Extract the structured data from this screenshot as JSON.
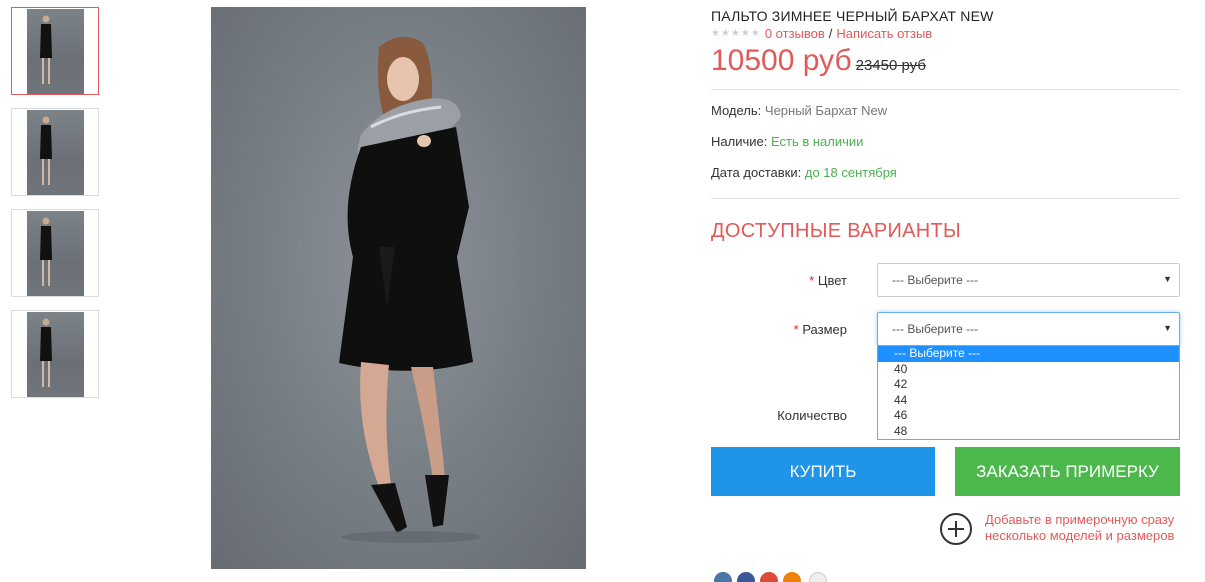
{
  "product": {
    "title": "ПАЛЬТО ЗИМНЕЕ ЧЕРНЫЙ БАРХАТ NEW",
    "rating_stars": 0,
    "reviews_link": "0 отзывов",
    "separator": "/",
    "write_review_link": "Написать отзыв",
    "price": "10500 руб",
    "old_price": "23450 руб",
    "model_label": "Модель:",
    "model_value": "Черный Бархат New",
    "availability_label": "Наличие:",
    "availability_value": "Есть в наличии",
    "delivery_label": "Дата доставки:",
    "delivery_value": "до 18 сентября"
  },
  "variants": {
    "heading": "ДОСТУПНЫЕ ВАРИАНТЫ",
    "color": {
      "required_mark": "*",
      "label": "Цвет",
      "value": "--- Выберите ---"
    },
    "size": {
      "required_mark": "*",
      "label": "Размер",
      "value": "--- Выберите ---",
      "options": [
        "--- Выберите ---",
        "40",
        "42",
        "44",
        "46",
        "48"
      ],
      "highlighted_index": 0
    },
    "quantity_label": "Количество"
  },
  "actions": {
    "buy_label": "КУПИТЬ",
    "fitting_label": "ЗАКАЗАТЬ ПРИМЕРКУ",
    "add_fitting_text": "Добавьте в примерочную сразу несколько моделей и размеров"
  },
  "gallery": {
    "thumbnails": 4,
    "active_thumbnail": 0
  },
  "icons": {
    "dropdown_arrow": "▼",
    "add_fitting_icon": "plus-circle-icon",
    "social": [
      "vk-icon",
      "facebook-icon",
      "google-plus-icon",
      "odnoklassniki-icon",
      "counter-icon"
    ]
  },
  "colors": {
    "accent_red": "#e05a5a",
    "in_stock_green": "#4caf50",
    "buy_blue": "#1e95e8",
    "fitting_green": "#4cb84c",
    "option_highlight": "#1e90ff"
  }
}
